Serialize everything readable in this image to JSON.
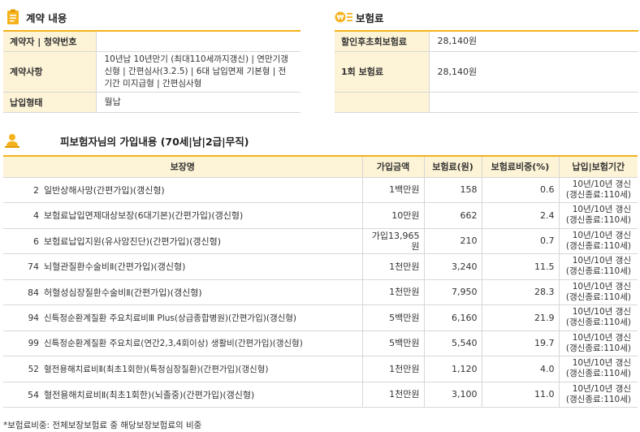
{
  "contract": {
    "title": "계약 내용",
    "rows": [
      {
        "label": "계약자 | 청약번호",
        "value": ""
      },
      {
        "label": "계약사항",
        "value": "10년납 10년만기 (최대110세까지갱신) | 연만기갱신형 | 간편심사(3.2.5) | 6대 납입면제 기본형 | 전기간 미지급형 | 간편심사형"
      },
      {
        "label": "납입형태",
        "value": "월납"
      }
    ]
  },
  "premium": {
    "title": "보험료",
    "rows": [
      {
        "label": "할인후초회보험료",
        "value": "28,140원"
      },
      {
        "label": "1회 보험료",
        "value": "28,140원"
      },
      {
        "label": "",
        "value": ""
      }
    ]
  },
  "coverage": {
    "title": "피보험자님의 가입내용 (70세|남|2급|무직)",
    "headers": [
      "보장명",
      "가입금액",
      "보험료(원)",
      "보험료비중(%)",
      "납입|보험기간"
    ],
    "rows": [
      {
        "no": "2",
        "name": "일반상해사망(간편가입)(갱신형)",
        "amount": "1백만원",
        "premium": "158",
        "ratio": "0.6",
        "period1": "10년/10년 갱신",
        "period2": "(갱신종료:110세)"
      },
      {
        "no": "4",
        "name": "보험료납입면제대상보장(6대기본)(간편가입)(갱신형)",
        "amount": "10만원",
        "premium": "662",
        "ratio": "2.4",
        "period1": "10년/10년 갱신",
        "period2": "(갱신종료:110세)"
      },
      {
        "no": "6",
        "name": "보험료납입지원(유사암진단)(간편가입)(갱신형)",
        "amount": "가입13,965원",
        "premium": "210",
        "ratio": "0.7",
        "period1": "10년/10년 갱신",
        "period2": "(갱신종료:110세)"
      },
      {
        "no": "74",
        "name": "뇌혈관질환수술비Ⅱ(간편가입)(갱신형)",
        "amount": "1천만원",
        "premium": "3,240",
        "ratio": "11.5",
        "period1": "10년/10년 갱신",
        "period2": "(갱신종료:110세)"
      },
      {
        "no": "84",
        "name": "허혈성심장질환수술비Ⅱ(간편가입)(갱신형)",
        "amount": "1천만원",
        "premium": "7,950",
        "ratio": "28.3",
        "period1": "10년/10년 갱신",
        "period2": "(갱신종료:110세)"
      },
      {
        "no": "94",
        "name": "신특정순환계질환 주요치료비Ⅲ Plus(상급종합병원)(간편가입)(갱신형)",
        "amount": "5백만원",
        "premium": "6,160",
        "ratio": "21.9",
        "period1": "10년/10년 갱신",
        "period2": "(갱신종료:110세)"
      },
      {
        "no": "99",
        "name": "신특정순환계질환 주요치료(연간2,3,4회이상) 생활비(간편가입)(갱신형)",
        "amount": "5백만원",
        "premium": "5,540",
        "ratio": "19.7",
        "period1": "10년/10년 갱신",
        "period2": "(갱신종료:110세)"
      },
      {
        "no": "52",
        "name": "혈전용해치료비Ⅱ(최초1회한)(특정심장질환)(간편가입)(갱신형)",
        "amount": "1천만원",
        "premium": "1,120",
        "ratio": "4.0",
        "period1": "10년/10년 갱신",
        "period2": "(갱신종료:110세)"
      },
      {
        "no": "54",
        "name": "혈전용해치료비Ⅱ(최초1회한)(뇌졸중)(간편가입)(갱신형)",
        "amount": "1천만원",
        "premium": "3,100",
        "ratio": "11.0",
        "period1": "10년/10년 갱신",
        "period2": "(갱신종료:110세)"
      }
    ]
  },
  "footnote": "*보험료비중: 전체보장보험료 중 해당보장보험료의 비중",
  "colors": {
    "accent": "#f5b21c",
    "header_bg": "#fdf3d6"
  }
}
